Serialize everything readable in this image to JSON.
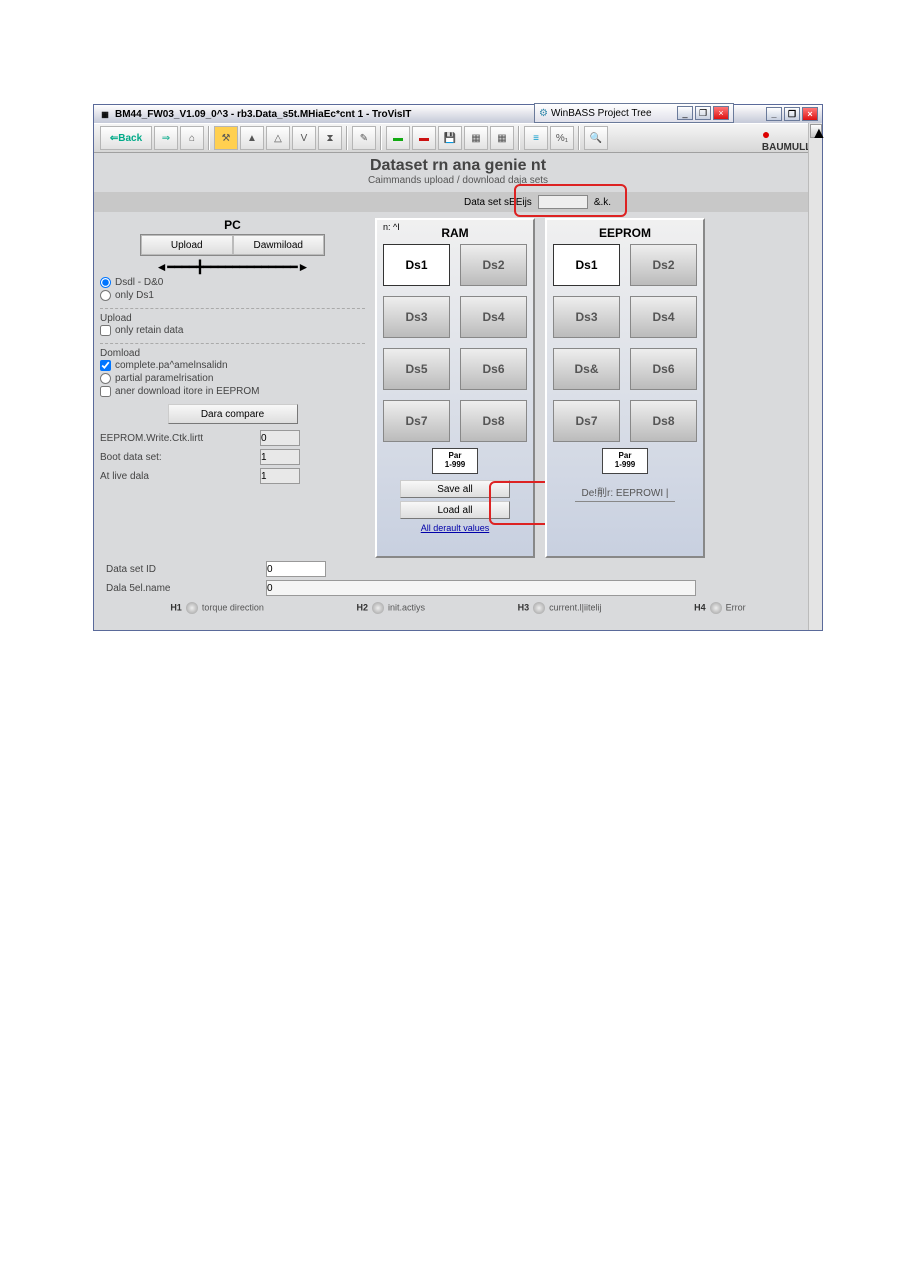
{
  "window": {
    "title": "BM44_FW03_V1.09_0^3 - rb3.Data_s5t.MHiaEc*cnt 1 - TroVisIT"
  },
  "project_tree": {
    "title": "WinBASS Project Tree"
  },
  "toolbar": {
    "back": "Back"
  },
  "logo": "BAUMULLE",
  "page": {
    "heading": "Dataset rn ana genie nt",
    "sub": "Caimmands upload / download daja sets"
  },
  "dsbar": {
    "label": "Data set sEEijs",
    "status": "&.k."
  },
  "left": {
    "pc": "PC",
    "upload_btn": "Upload",
    "download_btn": "Dawmiload",
    "r1": "Dsdl - D&0",
    "r2": "only Ds1",
    "upload_hdr": "Upload",
    "chk_retain": "only retain data",
    "download_hdr": "Domload",
    "chk_complete": "complete.pa^amelnsalidn",
    "chk_partial": "partial paramelrisation",
    "chk_after": "aner download itore in EEPROM",
    "compare_btn": "Dara compare",
    "f_eeprom": "EEPROM.Write.Ctk.lirtt",
    "f_boot": "Boot data set:",
    "f_active": "At live dala",
    "f_id": "Data set ID",
    "f_name": "Dala 5el.name",
    "v_eeprom": "0",
    "v_boot": "1",
    "v_active": "1",
    "v_id": "0",
    "v_name": "0"
  },
  "ram": {
    "hdr": "RAM",
    "corner": "n:  ^I",
    "ds": [
      "Ds1",
      "Ds2",
      "Ds3",
      "Ds4",
      "Ds5",
      "Ds6",
      "Ds7",
      "Ds8"
    ],
    "par": "Par",
    "par2": "1-999",
    "saveall": "Save all",
    "loadall": "Load all",
    "defaults": "All derault values"
  },
  "eep": {
    "hdr": "EEPROM",
    "ds": [
      "Ds1",
      "Ds2",
      "Ds3",
      "Ds4",
      "Ds&",
      "Ds6",
      "Ds7",
      "Ds8"
    ],
    "par": "Par",
    "par2": "1-999",
    "delete": "De!削r: EEPROWI |"
  },
  "status": {
    "h1": "H1",
    "h1t": "torque direction",
    "h2": "H2",
    "h2t": "init.actiys",
    "h3": "H3",
    "h3t": "current.l|iitelij",
    "h4": "H4",
    "h4t": "Error"
  }
}
